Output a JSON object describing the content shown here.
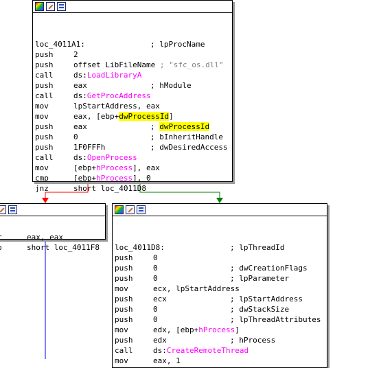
{
  "colors": {
    "background": "#ffffff",
    "block_border": "#000000",
    "block_shadow": "#9a9a9a",
    "edge_false": "#ff0000",
    "edge_true": "#008000",
    "edge_flow": "#0000ff",
    "import_name": "#ff00ff",
    "comment_string": "#808080",
    "highlight": "#ffff00"
  },
  "blocks": {
    "main": {
      "toolbar_icons": [
        "color-icon",
        "edit-icon",
        "graph-icon"
      ],
      "lines": [
        {
          "label": "loc_4011A1:",
          "comment": "; lpProcName"
        },
        {
          "op": "push",
          "arg": "2"
        },
        {
          "op": "push",
          "arg": "offset LibFileName",
          "str": "; \"sfc_os.dll\""
        },
        {
          "op": "call",
          "pre": "ds:",
          "name": "LoadLibraryA"
        },
        {
          "op": "push",
          "arg": "eax",
          "comment": "; hModule"
        },
        {
          "op": "call",
          "pre": "ds:",
          "name": "GetProcAddress"
        },
        {
          "op": "mov",
          "arg": "lpStartAddress, eax"
        },
        {
          "op": "mov",
          "pre": "eax, [ebp+",
          "hl": "dwProcessId",
          "post": "]"
        },
        {
          "op": "push",
          "arg": "eax",
          "hlcomment": "dwProcessId"
        },
        {
          "op": "push",
          "arg": "0",
          "comment": "; bInheritHandle"
        },
        {
          "op": "push",
          "arg": "1F0FFFh",
          "comment": "; dwDesiredAccess"
        },
        {
          "op": "call",
          "pre": "ds:",
          "name": "OpenProcess"
        },
        {
          "op": "mov",
          "pre": "[ebp+",
          "name": "hProcess",
          "post": "], eax"
        },
        {
          "op": "cmp",
          "pre": "[ebp+",
          "name": "hProcess",
          "post": "], 0"
        },
        {
          "op": "jnz",
          "arg": "short loc_4011D8"
        }
      ]
    },
    "left": {
      "toolbar_icons": [
        "edit-icon",
        "graph-icon"
      ],
      "lines": [
        {
          "op": "r",
          "arg": "eax, eax"
        },
        {
          "op": "p",
          "arg": "short loc_4011F8"
        }
      ]
    },
    "right": {
      "toolbar_icons": [
        "color-icon",
        "edit-icon",
        "graph-icon"
      ],
      "lines": [
        {
          "label": "loc_4011D8:",
          "comment": "; lpThreadId"
        },
        {
          "op": "push",
          "arg": "0"
        },
        {
          "op": "push",
          "arg": "0",
          "comment": "; dwCreationFlags"
        },
        {
          "op": "push",
          "arg": "0",
          "comment": "; lpParameter"
        },
        {
          "op": "mov",
          "arg": "ecx, lpStartAddress"
        },
        {
          "op": "push",
          "arg": "ecx",
          "comment": "; lpStartAddress"
        },
        {
          "op": "push",
          "arg": "0",
          "comment": "; dwStackSize"
        },
        {
          "op": "push",
          "arg": "0",
          "comment": "; lpThreadAttributes"
        },
        {
          "op": "mov",
          "pre": "edx, [ebp+",
          "name": "hProcess",
          "post": "]"
        },
        {
          "op": "push",
          "arg": "edx",
          "comment": "; hProcess"
        },
        {
          "op": "call",
          "pre": "ds:",
          "name": "CreateRemoteThread"
        },
        {
          "op": "mov",
          "arg": "eax, 1"
        }
      ]
    }
  }
}
